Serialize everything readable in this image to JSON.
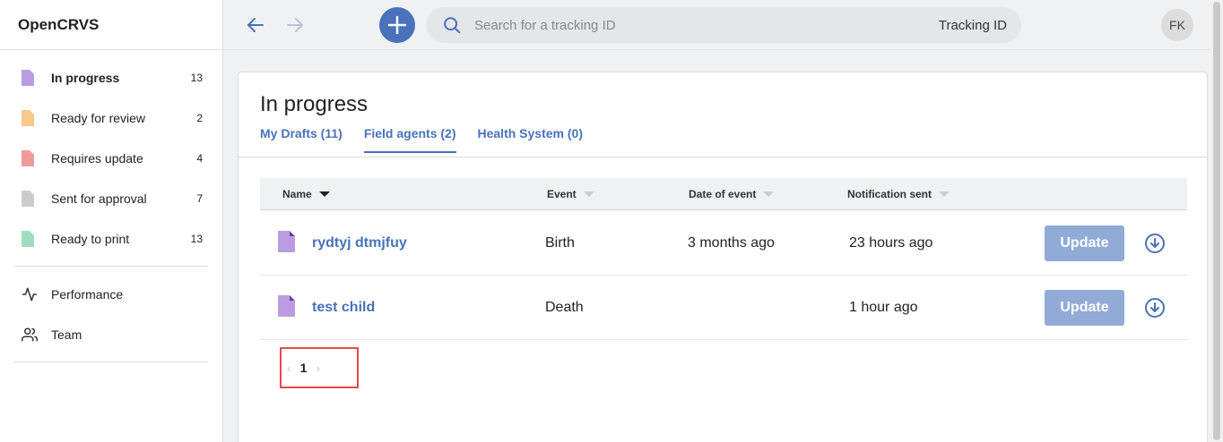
{
  "app": {
    "title": "OpenCRVS"
  },
  "sidebar": {
    "items": [
      {
        "label": "In progress",
        "count": "13",
        "color": "#b99de0"
      },
      {
        "label": "Ready for review",
        "count": "2",
        "color": "#f7c98b"
      },
      {
        "label": "Requires update",
        "count": "4",
        "color": "#f09a9a"
      },
      {
        "label": "Sent for approval",
        "count": "7",
        "color": "#cccccc"
      },
      {
        "label": "Ready to print",
        "count": "13",
        "color": "#9fdcc0"
      }
    ],
    "secondary": [
      {
        "label": "Performance",
        "icon": "activity-icon"
      },
      {
        "label": "Team",
        "icon": "users-icon"
      }
    ]
  },
  "topbar": {
    "search_placeholder": "Search for a tracking ID",
    "search_type": "Tracking ID",
    "avatar_initials": "FK"
  },
  "main": {
    "title": "In progress",
    "tabs": [
      {
        "label": "My Drafts (11)"
      },
      {
        "label": "Field agents (2)",
        "active": true
      },
      {
        "label": "Health System (0)"
      }
    ],
    "columns": [
      "Name",
      "Event",
      "Date of event",
      "Notification sent"
    ],
    "rows": [
      {
        "name": "rydtyj dtmjfuy",
        "event": "Birth",
        "date": "3 months ago",
        "sent": "23 hours ago",
        "action": "Update"
      },
      {
        "name": "test child",
        "event": "Death",
        "date": "",
        "sent": "1 hour ago",
        "action": "Update"
      }
    ],
    "pagination": {
      "current": "1",
      "prev": "‹",
      "next": "›"
    }
  },
  "colors": {
    "accent": "#4972bb",
    "button_disabled": "#91abd7",
    "highlight": "#e84a4a"
  }
}
